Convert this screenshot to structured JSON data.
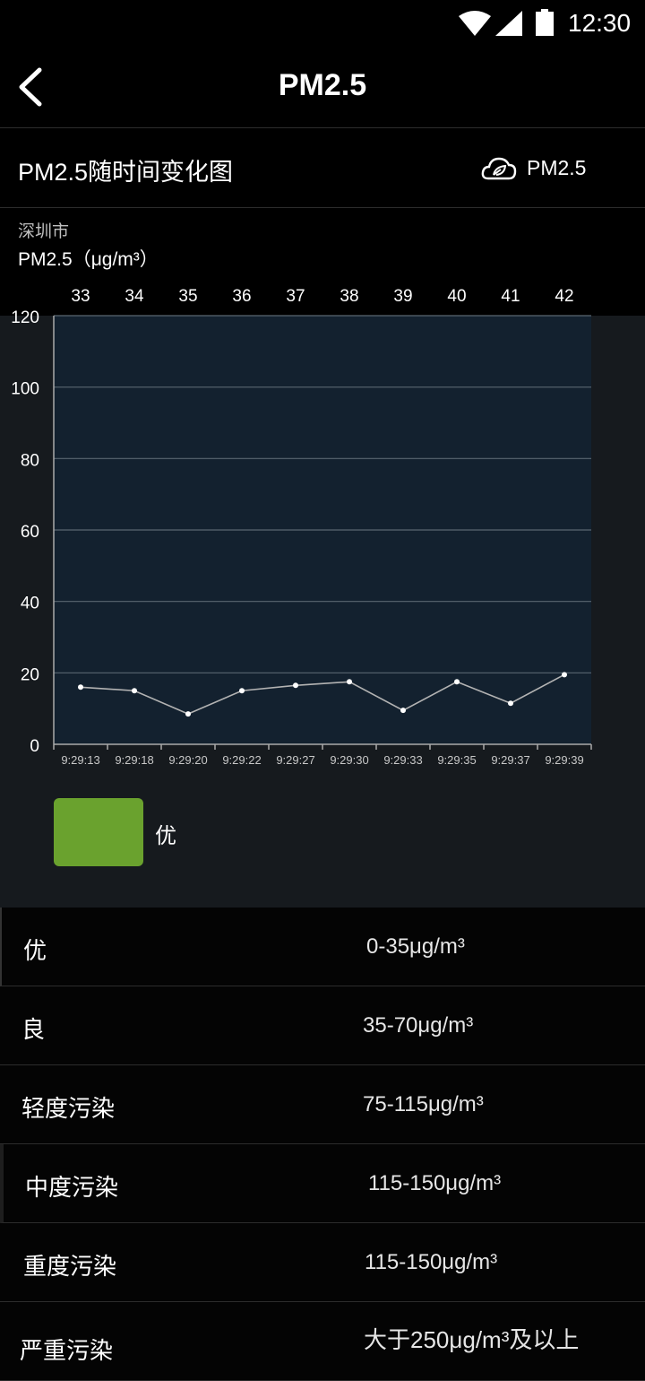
{
  "status_bar": {
    "time": "12:30",
    "icons": [
      "wifi-icon",
      "signal-icon",
      "battery-icon"
    ]
  },
  "app_bar": {
    "title": "PM2.5",
    "back_icon": "chevron-left-icon"
  },
  "section": {
    "label": "PM2.5随时间变化图",
    "tag": "PM2.5",
    "tag_icon": "cloud-leaf-icon"
  },
  "chart_header": {
    "city": "深圳市",
    "unit": "PM2.5（μg/m³）"
  },
  "chart_data": {
    "type": "line",
    "top_labels": [
      "33",
      "34",
      "35",
      "36",
      "37",
      "38",
      "39",
      "40",
      "41",
      "42"
    ],
    "categories": [
      "9:29:13",
      "9:29:18",
      "9:29:20",
      "9:29:22",
      "9:29:27",
      "9:29:30",
      "9:29:33",
      "9:29:35",
      "9:29:37",
      "9:29:39"
    ],
    "values": [
      16,
      15,
      8.5,
      15,
      16.5,
      17.5,
      9.5,
      17.5,
      11.5,
      19.5
    ],
    "yticks": [
      0,
      20,
      40,
      60,
      80,
      100,
      120
    ],
    "ylim": [
      0,
      120
    ],
    "grid": true,
    "line_color": "#b3b3b3",
    "plot_bg": "#13212f"
  },
  "legend": {
    "label": "优",
    "color": "#6aa22e"
  },
  "levels": [
    {
      "name": "优",
      "range": "0-35μg/m³"
    },
    {
      "name": "良",
      "range": "35-70μg/m³"
    },
    {
      "name": "轻度污染",
      "range": "75-115μg/m³"
    },
    {
      "name": "中度污染",
      "range": "115-150μg/m³"
    },
    {
      "name": "重度污染",
      "range": "115-150μg/m³"
    },
    {
      "name": "严重污染",
      "range": "大于250μg/m³及以上"
    }
  ]
}
